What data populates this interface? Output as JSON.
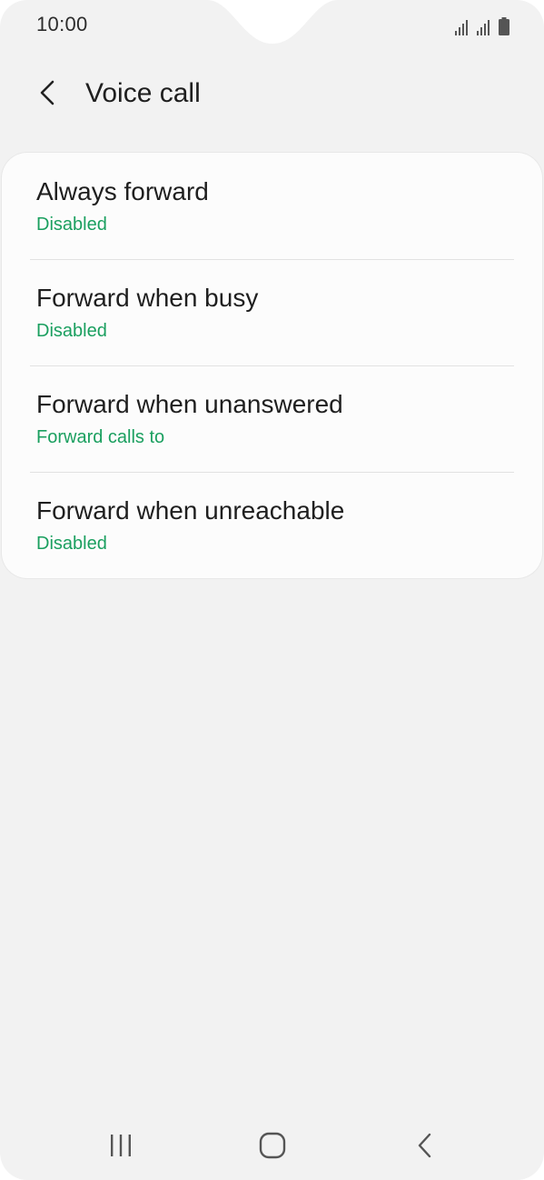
{
  "status_bar": {
    "time": "10:00",
    "icons": [
      "signal-sim1-icon",
      "signal-sim2-icon",
      "battery-icon"
    ]
  },
  "header": {
    "title": "Voice call",
    "back_icon": "chevron-left-icon"
  },
  "list": {
    "items": [
      {
        "title": "Always forward",
        "subtitle": "Disabled"
      },
      {
        "title": "Forward when busy",
        "subtitle": "Disabled"
      },
      {
        "title": "Forward when unanswered",
        "subtitle": "Forward calls to"
      },
      {
        "title": "Forward when unreachable",
        "subtitle": "Disabled"
      }
    ]
  },
  "nav_bar": {
    "recents_icon": "recents-icon",
    "home_icon": "home-icon",
    "back_icon": "back-icon"
  },
  "colors": {
    "accent": "#1a9f5f",
    "background": "#f2f2f2",
    "card": "#fcfcfc",
    "text_primary": "#1f1f1f"
  }
}
